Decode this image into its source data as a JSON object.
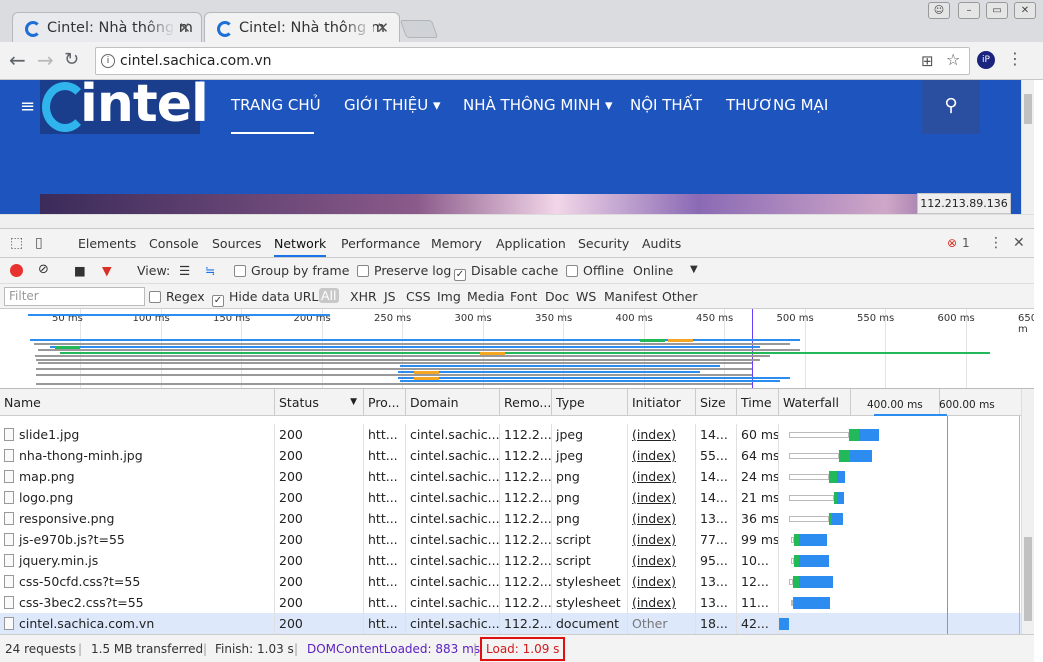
{
  "browser": {
    "tabs": [
      {
        "title": "Cintel: Nhà thông m",
        "active": false
      },
      {
        "title": "Cintel: Nhà thông m",
        "active": true
      }
    ],
    "url": "cintel.sachica.com.vn"
  },
  "site": {
    "logo_text": "intel",
    "nav": [
      "TRANG CHỦ",
      "GIỚI THIỆU ▾",
      "NHÀ THÔNG MINH ▾",
      "NỘI THẤT",
      "THƯƠNG MẠI"
    ],
    "ip_tooltip": "112.213.89.136"
  },
  "devtools": {
    "tabs": [
      "Elements",
      "Console",
      "Sources",
      "Network",
      "Performance",
      "Memory",
      "Application",
      "Security",
      "Audits"
    ],
    "active_tab": "Network",
    "error_count": "1",
    "network_toolbar": {
      "view_label": "View:",
      "group_by_frame": "Group by frame",
      "preserve_log": "Preserve log",
      "disable_cache": "Disable cache",
      "offline": "Offline",
      "throttle": "Online"
    },
    "filter": {
      "placeholder": "Filter",
      "regex": "Regex",
      "hide_data_urls": "Hide data URLs",
      "types": [
        "All",
        "XHR",
        "JS",
        "CSS",
        "Img",
        "Media",
        "Font",
        "Doc",
        "WS",
        "Manifest",
        "Other"
      ]
    },
    "overview_ticks": [
      "50 ms",
      "100 ms",
      "150 ms",
      "200 ms",
      "250 ms",
      "300 ms",
      "350 ms",
      "400 ms",
      "450 ms",
      "500 ms",
      "550 ms",
      "600 ms",
      "650 m"
    ],
    "columns": [
      "Name",
      "Status",
      "Pro...",
      "Domain",
      "Remo...",
      "Type",
      "Initiator",
      "Size",
      "Time",
      "Waterfall"
    ],
    "waterfall_ticks": [
      "400.00 ms",
      "600.00 ms"
    ],
    "rows": [
      {
        "name": "slide1.jpg",
        "status": "200",
        "protocol": "htt...",
        "domain": "cintel.sachic...",
        "remote": "112.2...",
        "type": "jpeg",
        "initiator": "(index)",
        "size": "14...",
        "time": "60 ms",
        "wf": [
          10,
          70,
          80,
          100
        ]
      },
      {
        "name": "nha-thong-minh.jpg",
        "status": "200",
        "protocol": "htt...",
        "domain": "cintel.sachic...",
        "remote": "112.2...",
        "type": "jpeg",
        "initiator": "(index)",
        "size": "55...",
        "time": "64 ms",
        "wf": [
          10,
          60,
          71,
          93
        ]
      },
      {
        "name": "map.png",
        "status": "200",
        "protocol": "htt...",
        "domain": "cintel.sachic...",
        "remote": "112.2...",
        "type": "png",
        "initiator": "(index)",
        "size": "14...",
        "time": "24 ms",
        "wf": [
          10,
          50,
          58,
          66
        ]
      },
      {
        "name": "logo.png",
        "status": "200",
        "protocol": "htt...",
        "domain": "cintel.sachic...",
        "remote": "112.2...",
        "type": "png",
        "initiator": "(index)",
        "size": "14...",
        "time": "21 ms",
        "wf": [
          10,
          55,
          58,
          65
        ]
      },
      {
        "name": "responsive.png",
        "status": "200",
        "protocol": "htt...",
        "domain": "cintel.sachic...",
        "remote": "112.2...",
        "type": "png",
        "initiator": "(index)",
        "size": "13...",
        "time": "36 ms",
        "wf": [
          10,
          50,
          53,
          64
        ]
      },
      {
        "name": "js-e970b.js?t=55",
        "status": "200",
        "protocol": "htt...",
        "domain": "cintel.sachic...",
        "remote": "112.2...",
        "type": "script",
        "initiator": "(index)",
        "size": "77...",
        "time": "99 ms",
        "wf": [
          12,
          15,
          20,
          48
        ]
      },
      {
        "name": "jquery.min.js",
        "status": "200",
        "protocol": "htt...",
        "domain": "cintel.sachic...",
        "remote": "112.2...",
        "type": "script",
        "initiator": "(index)",
        "size": "95...",
        "time": "10...",
        "wf": [
          12,
          15,
          20,
          50
        ]
      },
      {
        "name": "css-50cfd.css?t=55",
        "status": "200",
        "protocol": "htt...",
        "domain": "cintel.sachic...",
        "remote": "112.2...",
        "type": "stylesheet",
        "initiator": "(index)",
        "size": "13...",
        "time": "12...",
        "wf": [
          10,
          14,
          20,
          54
        ]
      },
      {
        "name": "css-3bec2.css?t=55",
        "status": "200",
        "protocol": "htt...",
        "domain": "cintel.sachic...",
        "remote": "112.2...",
        "type": "stylesheet",
        "initiator": "(index)",
        "size": "13...",
        "time": "11...",
        "wf": [
          12,
          14,
          15,
          51
        ]
      },
      {
        "name": "cintel.sachica.com.vn",
        "status": "200",
        "protocol": "htt...",
        "domain": "cintel.sachic...",
        "remote": "112.2...",
        "type": "document",
        "initiator": "Other",
        "size": "18...",
        "time": "42...",
        "wf": [
          0,
          0,
          1,
          10
        ]
      }
    ],
    "status_bar": {
      "requests": "24 requests",
      "transferred": "1.5 MB transferred",
      "finish": "Finish: 1.03 s",
      "dom_loaded": "DOMContentLoaded: 883 ms",
      "load": "Load: 1.09 s"
    },
    "colors": {
      "dom_loaded": "#5b1ec2",
      "load": "#d11a1a",
      "waterfall_receive": "#2d8cf0",
      "waterfall_waiting": "#21b95a",
      "accent": "#1a73e8"
    }
  }
}
